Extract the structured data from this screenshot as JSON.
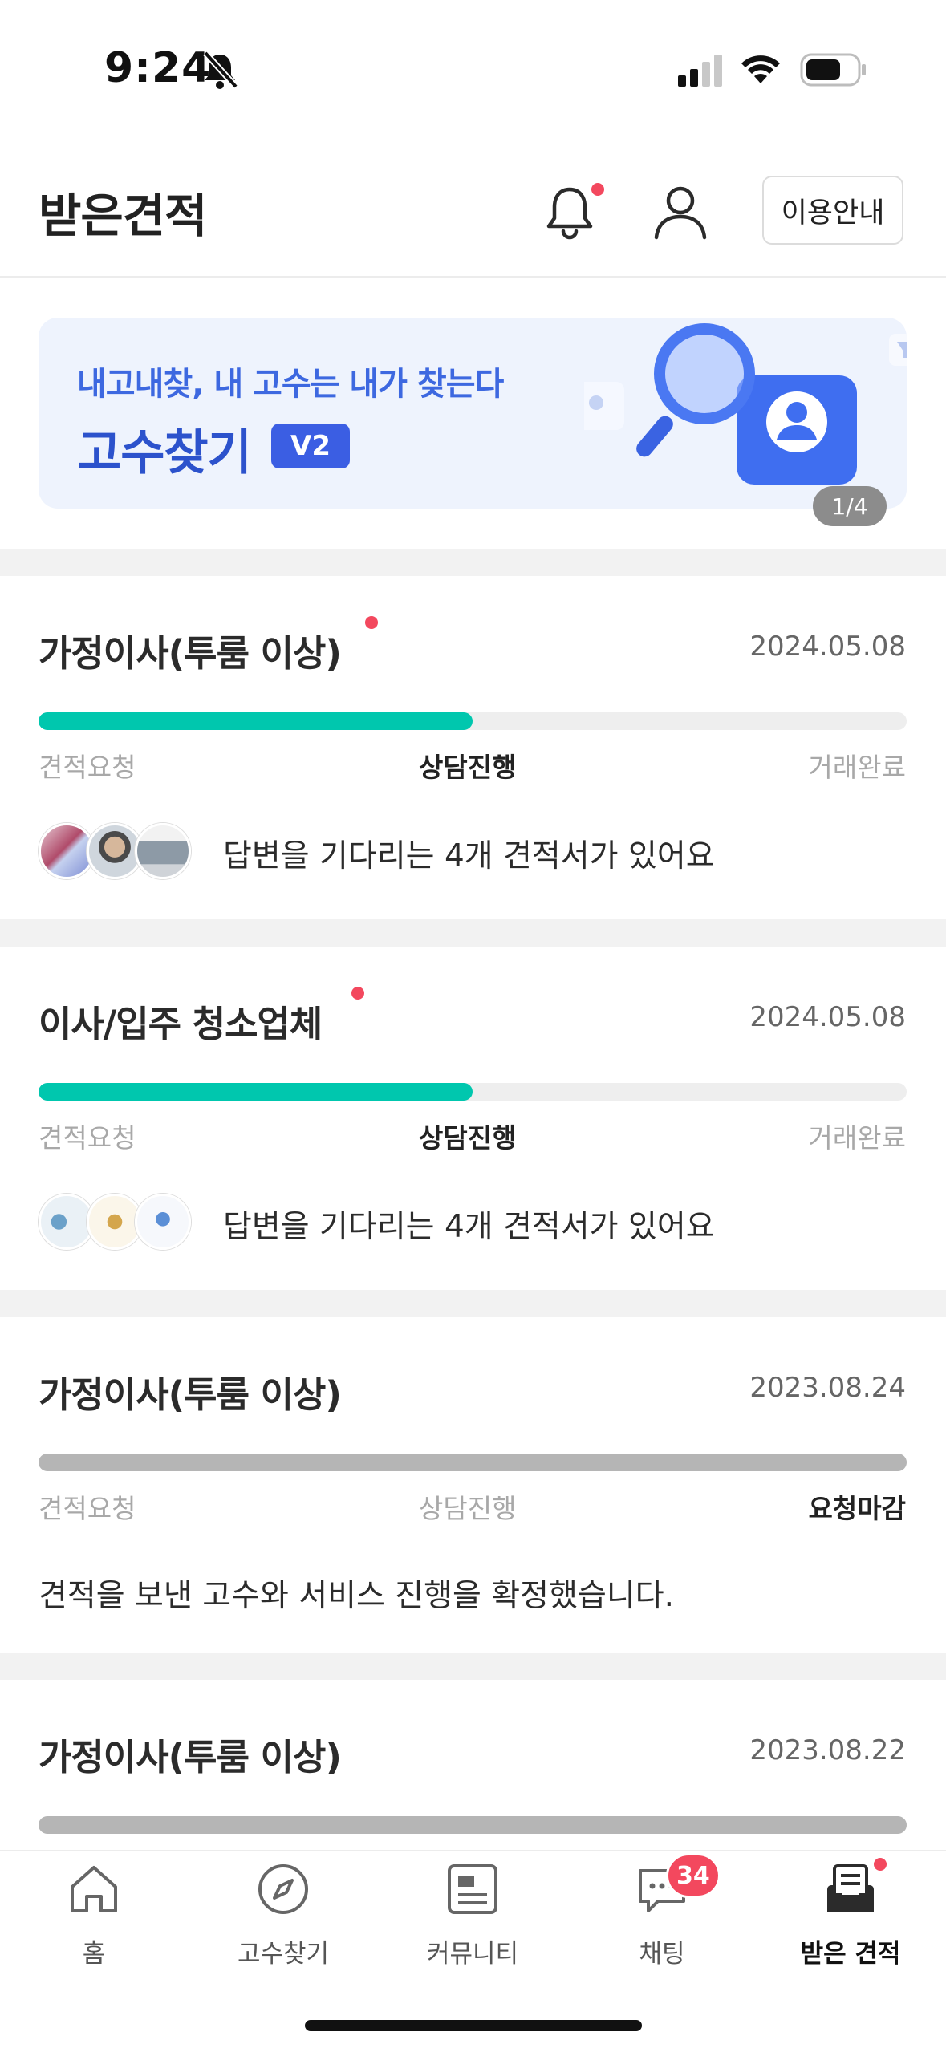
{
  "status_bar": {
    "time": "9:24"
  },
  "header": {
    "title": "받은견적",
    "guide_label": "이용안내"
  },
  "banner": {
    "subtitle": "내고내찾, 내 고수는 내가 찾는다",
    "title": "고수찾기",
    "badge": "V2",
    "page_indicator": "1/4"
  },
  "cards": [
    {
      "title": "가정이사(투룸 이상)",
      "date": "2024.05.08",
      "progress": 0.5,
      "progress_color": "#00c7ae",
      "steps": [
        "견적요청",
        "상담진행",
        "거래완료"
      ],
      "active_step": 1,
      "message": "답변을 기다리는 4개 견적서가 있어요",
      "unread": true
    },
    {
      "title": "이사/입주 청소업체",
      "date": "2024.05.08",
      "progress": 0.5,
      "progress_color": "#00c7ae",
      "steps": [
        "견적요청",
        "상담진행",
        "거래완료"
      ],
      "active_step": 1,
      "message": "답변을 기다리는 4개 견적서가 있어요",
      "unread": true
    },
    {
      "title": "가정이사(투룸 이상)",
      "date": "2023.08.24",
      "progress": 1.0,
      "progress_color": "#b5b5b5",
      "steps": [
        "견적요청",
        "상담진행",
        "요청마감"
      ],
      "active_step": 2,
      "message": "견적을 보낸 고수와 서비스 진행을 확정했습니다.",
      "unread": false
    },
    {
      "title": "가정이사(투룸 이상)",
      "date": "2023.08.22",
      "progress": 1.0,
      "progress_color": "#b5b5b5",
      "unread": false
    }
  ],
  "tabbar": {
    "items": [
      {
        "label": "홈",
        "icon": "home-icon"
      },
      {
        "label": "고수찾기",
        "icon": "compass-icon"
      },
      {
        "label": "커뮤니티",
        "icon": "community-icon"
      },
      {
        "label": "채팅",
        "icon": "chat-icon",
        "badge": "34"
      },
      {
        "label": "받은 견적",
        "icon": "inbox-icon",
        "active": true
      }
    ]
  },
  "colors": {
    "accent_green": "#00c7ae",
    "badge_red": "#f3485e",
    "banner_blue": "#2c52cc"
  }
}
